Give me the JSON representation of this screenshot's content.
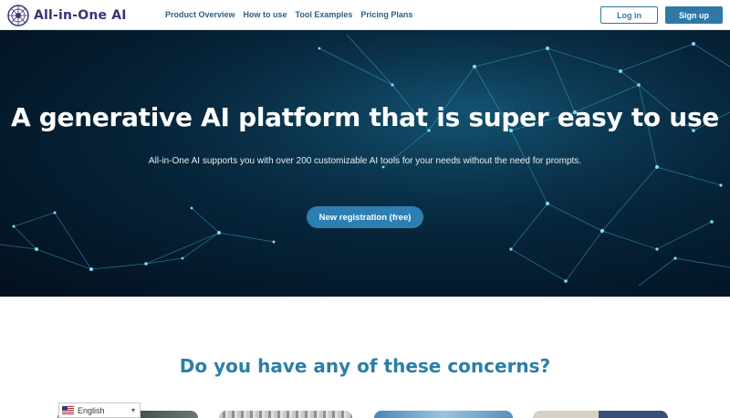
{
  "header": {
    "logo_text": "All-in-One AI",
    "nav": [
      "Product Overview",
      "How to use",
      "Tool Examples",
      "Pricing Plans"
    ],
    "login_label": "Log in",
    "signup_label": "Sign up"
  },
  "hero": {
    "title": "A generative AI platform that is super easy to use",
    "subtitle": "All-in-One AI supports you with over 200 customizable AI tools for your needs without the need for prompts.",
    "cta_label": "New registration (free)"
  },
  "concerns": {
    "title": "Do you have any of these concerns?"
  },
  "language_select": {
    "selected": "English",
    "icon": "us-flag-icon"
  },
  "colors": {
    "brand": "#3a3275",
    "accent": "#2f78a6",
    "heading": "#2c7ea6",
    "hero_bg": "#06243a"
  }
}
